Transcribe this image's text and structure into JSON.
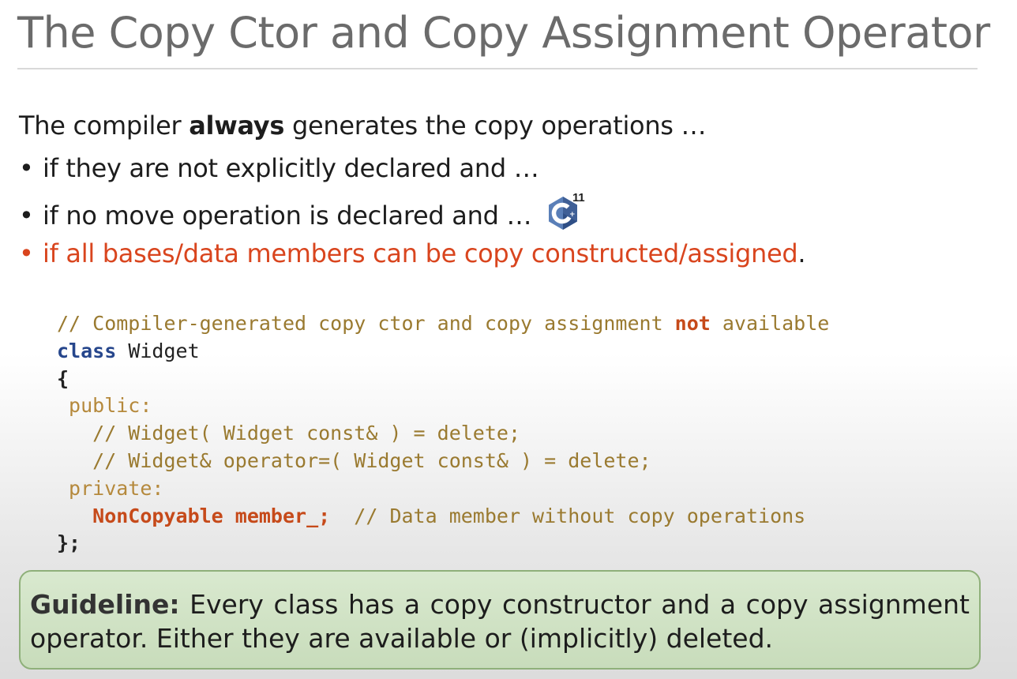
{
  "slide": {
    "title": "The Copy Ctor and Copy Assignment Operator"
  },
  "intro": {
    "before": "The compiler ",
    "bold": "always",
    "after": " generates the copy operations …"
  },
  "bullets": [
    {
      "marker": "•",
      "text": "if they are not explicitly declared and …"
    },
    {
      "marker": "•",
      "text": "if no move operation is declared and …",
      "badge_superscript": "11",
      "badge_icon": "cpp-logo-icon"
    },
    {
      "marker": "•",
      "text": "if all bases/data members can be copy constructed/assigned",
      "trailing": "."
    }
  ],
  "code": {
    "line1_comment": "// Compiler-generated copy ctor and copy assignment ",
    "line1_highlight": "not",
    "line1_tail": " available",
    "line2_kw": "class",
    "line2_name": " Widget",
    "line3": "{",
    "line4_kw": " public:",
    "line5": "   // Widget( Widget const& ) = delete;",
    "line6": "   // Widget& operator=( Widget const& ) = delete;",
    "line7_kw": " private:",
    "line8_indent": "   ",
    "line8_decl": "NonCopyable member_;",
    "line8_comment": "  // Data member without copy operations",
    "line9": "};"
  },
  "guideline": {
    "label": "Guideline:",
    "text": " Every class has a copy constructor and a copy assignment operator. Either they are available or (implicitly) deleted."
  },
  "colors": {
    "accent_red": "#d9451e",
    "comment": "#9a7a30",
    "keyword": "#26468c",
    "guideline_bg": "#d9e9cf"
  }
}
